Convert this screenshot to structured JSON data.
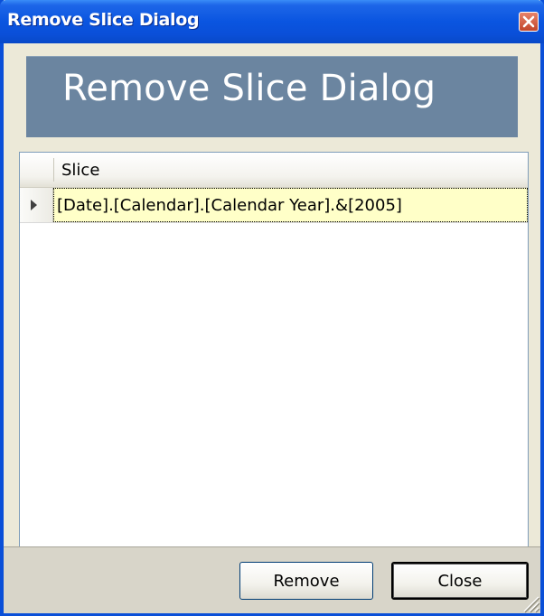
{
  "window": {
    "title": "Remove Slice Dialog"
  },
  "banner": {
    "title": "Remove Slice Dialog"
  },
  "grid": {
    "columns": [
      "Slice"
    ],
    "rows": [
      {
        "slice": "[Date].[Calendar].[Calendar Year].&[2005]",
        "selected": true
      }
    ]
  },
  "buttons": {
    "remove_label": "Remove",
    "close_label": "Close"
  },
  "colors": {
    "titlebar": "#0a4fd8",
    "banner": "#6b85a0",
    "selected_row": "#ffffc8",
    "close_button": "#c1452a"
  },
  "icons": {
    "close": "close-icon",
    "row_indicator": "row-pointer-icon",
    "resize": "resize-grip-icon"
  }
}
